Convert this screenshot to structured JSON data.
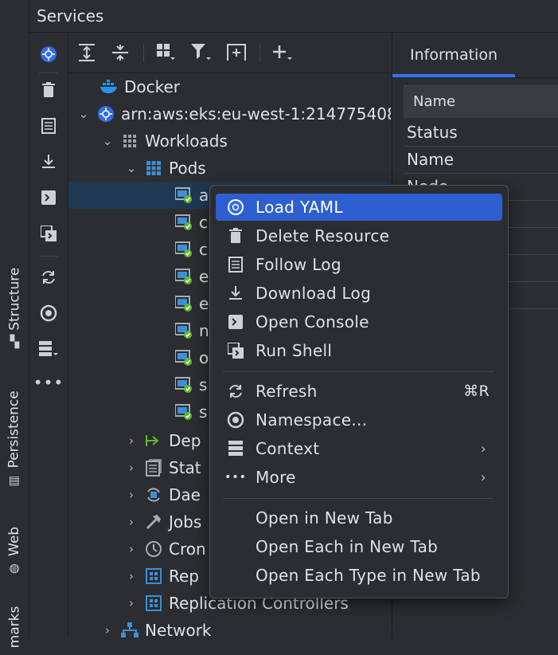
{
  "header": {
    "title": "Services"
  },
  "left_strip": {
    "tabs": [
      "Structure",
      "Persistence",
      "Web",
      "marks"
    ]
  },
  "right_panel": {
    "tab_label": "Information",
    "table_header": "Name",
    "rows": [
      "Status",
      "Name",
      "Node"
    ]
  },
  "tree": {
    "docker": "Docker",
    "cluster": "arn:aws:eks:eu-west-1:214775408",
    "workloads": "Workloads",
    "pods": "Pods",
    "pod_items": [
      "a",
      "c",
      "c",
      "e",
      "e",
      "n",
      "o",
      "s",
      "s"
    ],
    "deployments": "Dep",
    "stateful_sets": "Stat",
    "daemon_sets": "Dae",
    "jobs": "Jobs",
    "cron_jobs": "Cron",
    "replica_sets": "Rep",
    "replication_controllers": "Replication Controllers",
    "network": "Network"
  },
  "context_menu": {
    "load_yaml": "Load YAML",
    "delete_resource": "Delete Resource",
    "follow_log": "Follow Log",
    "download_log": "Download Log",
    "open_console": "Open Console",
    "run_shell": "Run Shell",
    "refresh": "Refresh",
    "refresh_shortcut": "⌘R",
    "namespace": "Namespace...",
    "context": "Context",
    "more": "More",
    "open_new_tab": "Open in New Tab",
    "open_each_new_tab": "Open Each in New Tab",
    "open_each_type_new_tab": "Open Each Type in New Tab"
  },
  "colors": {
    "background": "#2b2d30",
    "selection": "#1f3852",
    "menu_highlight": "#2e5fd0",
    "accent": "#3574f0",
    "k8s_blue": "#326ce5",
    "status_green": "#5fb832"
  }
}
